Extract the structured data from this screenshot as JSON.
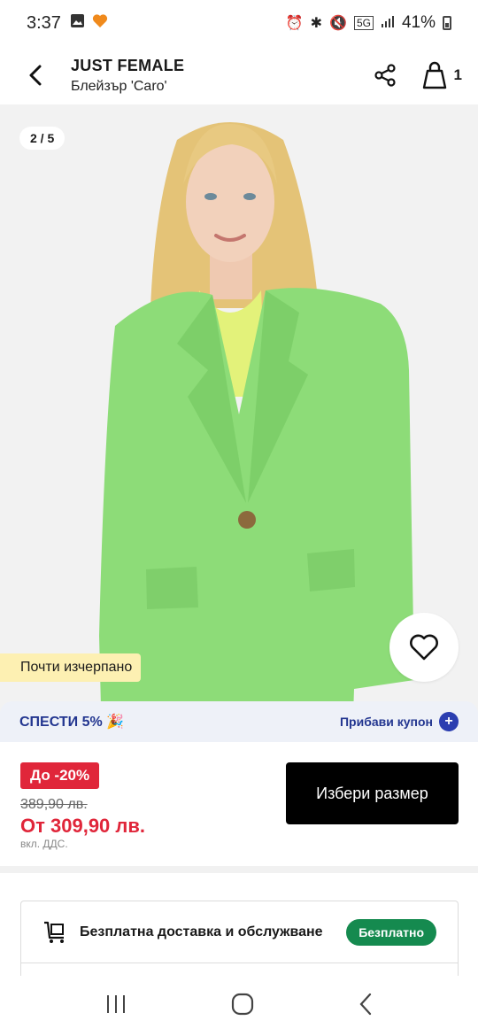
{
  "status_bar": {
    "time": "3:37",
    "network": "5G",
    "battery": "41%"
  },
  "header": {
    "brand": "JUST FEMALE",
    "product": "Блейзър 'Caro'",
    "cart_count": "1"
  },
  "gallery": {
    "counter": "2 / 5",
    "stock_badge": "Почти изчерпано",
    "colors": {
      "blazer": "#8ddc78",
      "background": "#f2f2f2"
    }
  },
  "coupon": {
    "save_text": "СПЕСТИ 5% 🎉",
    "add_coupon": "Прибави купон"
  },
  "price": {
    "discount": "До -20%",
    "old_price": "389,90 лв.",
    "new_price": "От 309,90 лв.",
    "vat": "вкл. ДДС.",
    "select_size": "Избери размер"
  },
  "delivery": {
    "text": "Безплатна доставка и обслужване",
    "badge": "Безплатно"
  },
  "colors": {
    "accent_red": "#e0263a",
    "accent_blue": "#2b3eb0",
    "green_badge": "#158a4f"
  }
}
